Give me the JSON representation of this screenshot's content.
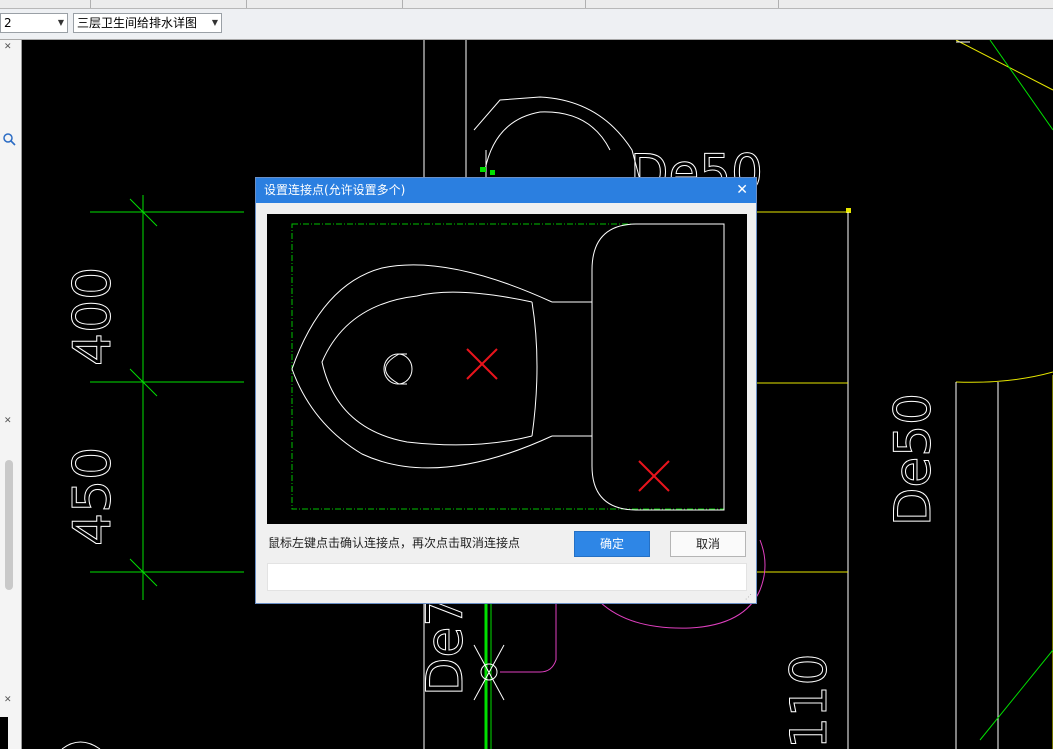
{
  "toolbar": {
    "floor_select_value": "2",
    "drawing_select_value": "三层卫生间给排水详图"
  },
  "drawing": {
    "dim_upper": "400",
    "dim_lower": "450",
    "label_de50_top": "De50",
    "label_de50_right": "De50",
    "label_de_partial": "De7",
    "label_110_partial": "110",
    "colors": {
      "dim": "#00e000",
      "line": "#ffffff",
      "pipe_yellow": "#e6e600",
      "pipe_magenta": "#e040c0"
    }
  },
  "dialog": {
    "title": "设置连接点(允许设置多个)",
    "close_icon": "close-icon",
    "hint": "鼠标左键点击确认连接点，再次点击取消连接点",
    "ok_label": "确定",
    "cancel_label": "取消",
    "connection_marker_color": "#e8141c"
  }
}
